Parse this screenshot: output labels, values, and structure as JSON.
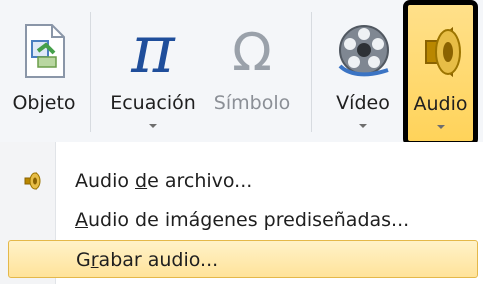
{
  "ribbon": {
    "objeto_label": "Objeto",
    "ecuacion_label": "Ecuación",
    "simbolo_label": "Símbolo",
    "video_label": "Vídeo",
    "audio_label": "Audio"
  },
  "menu": {
    "file_audio": {
      "before": "Audio ",
      "accel": "d",
      "after": "e archivo..."
    },
    "clip_audio": {
      "before": "",
      "accel": "A",
      "after": "udio de imágenes prediseñadas..."
    },
    "record_audio": {
      "before": "G",
      "accel": "r",
      "after": "abar audio..."
    }
  },
  "colors": {
    "audio_highlight": "#ffd35a",
    "hover_highlight": "#ffe39a",
    "outline": "#000000",
    "equation_pi": "#1f4e9b",
    "symbol_omega": "#9aa1aa"
  },
  "icons": {
    "objeto": "object-icon",
    "ecuacion": "pi-icon",
    "simbolo": "omega-icon",
    "video": "film-reel-icon",
    "audio": "speaker-icon",
    "menu_file": "speaker-icon"
  }
}
